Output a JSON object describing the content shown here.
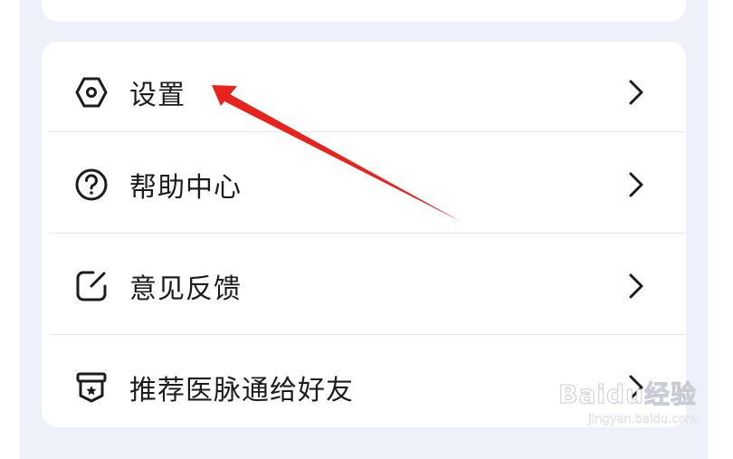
{
  "menu": {
    "items": [
      {
        "label": "设置",
        "icon": "settings-hexagon-icon"
      },
      {
        "label": "帮助中心",
        "icon": "help-circle-icon"
      },
      {
        "label": "意见反馈",
        "icon": "feedback-edit-icon"
      },
      {
        "label": "推荐医脉通给好友",
        "icon": "recommend-badge-icon"
      }
    ]
  },
  "watermark": {
    "logo": "Baidu经验",
    "url": "jingyan.baidu.com"
  },
  "colors": {
    "background": "#eef1f9",
    "card": "#ffffff",
    "annotation_arrow": "#e8231d"
  }
}
